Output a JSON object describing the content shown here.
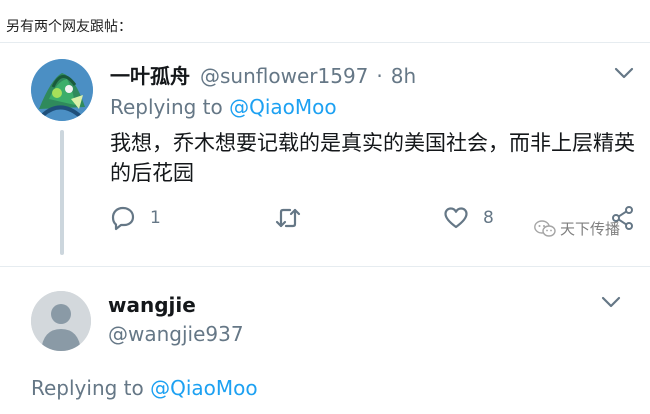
{
  "intro_text": "另有两个网友跟帖：",
  "tweet1": {
    "display_name": "一叶孤舟",
    "handle": "@sunflower1597",
    "separator": "·",
    "time": "8h",
    "replying_prefix": "Replying to ",
    "replying_to": "@QiaoMoo",
    "body": "我想，乔木想要记载的是真实的美国社会，而非上层精英的后花园",
    "actions": {
      "reply_count": "1",
      "retweet_count": "",
      "like_count": "8"
    },
    "icons": {
      "avatar": "avatar-image",
      "menu": "chevron-down-icon",
      "reply": "reply-icon",
      "retweet": "retweet-icon",
      "like": "heart-icon",
      "share": "share-icon"
    }
  },
  "watermark": {
    "text": "天下传播",
    "icon": "wechat-icon"
  },
  "tweet2": {
    "display_name": "wangjie",
    "handle": "@wangjie937",
    "replying_prefix": "Replying to ",
    "replying_to": "@QiaoMoo",
    "icons": {
      "avatar": "default-avatar-icon",
      "menu": "chevron-down-icon"
    }
  },
  "colors": {
    "text_primary": "#14171a",
    "text_secondary": "#657786",
    "link": "#1da1f2",
    "icon": "#657786",
    "divider": "#e6ecf0"
  }
}
